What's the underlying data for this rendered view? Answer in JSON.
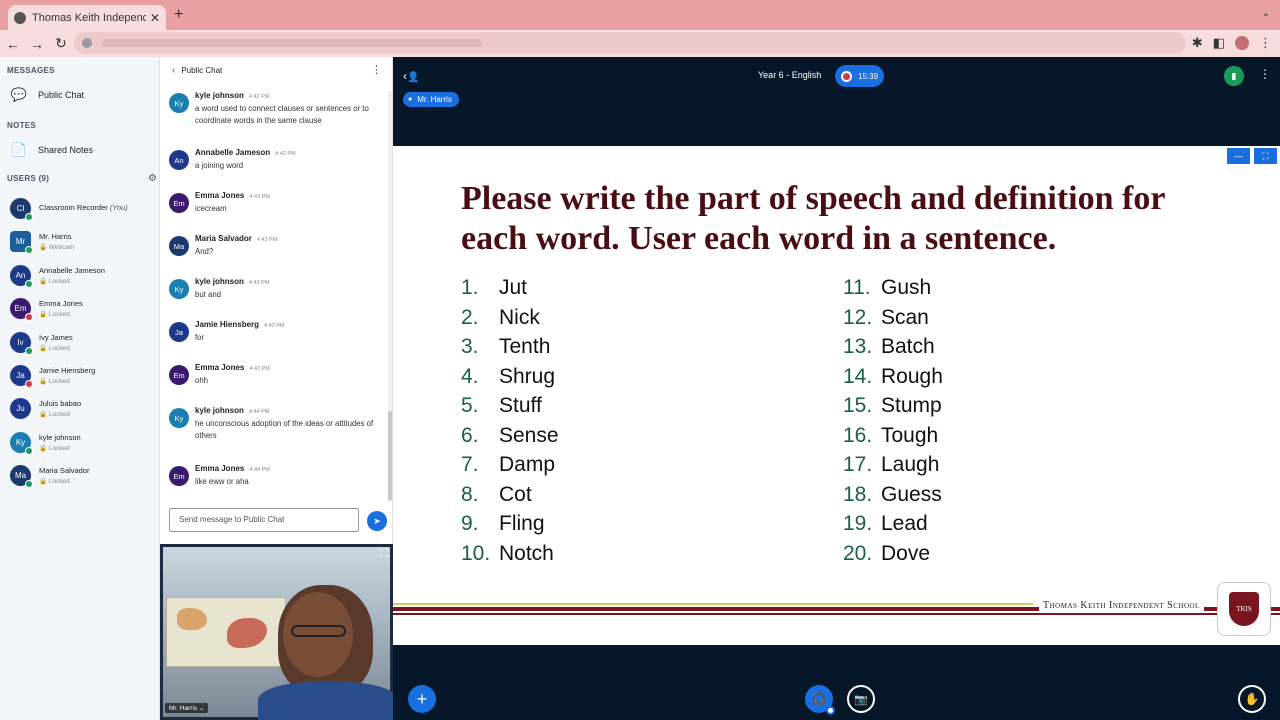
{
  "browser": {
    "tab_title": "Thomas Keith Independent Sc",
    "tab_close": "✕",
    "new_tab": "+",
    "tab_menu": "⌄"
  },
  "sidebar": {
    "messages_title": "MESSAGES",
    "public_chat": "Public Chat",
    "notes_title": "NOTES",
    "shared_notes": "Shared Notes",
    "users_title": "USERS (9)",
    "users": [
      {
        "initials": "Cl",
        "name": "Classroom Recorder",
        "suffix": "(You)",
        "sub": "",
        "color": "#1d3a6e",
        "status": "green"
      },
      {
        "initials": "Mr",
        "name": "Mr. Harris",
        "suffix": "",
        "sub": "Webcam",
        "color": "#1c5f9c",
        "status": "green"
      },
      {
        "initials": "An",
        "name": "Annabelle Jameson",
        "suffix": "",
        "sub": "Locked",
        "color": "#1d3a8a",
        "status": "green"
      },
      {
        "initials": "Em",
        "name": "Emma Jones",
        "suffix": "",
        "sub": "Locked",
        "color": "#3a1a6e",
        "status": "red"
      },
      {
        "initials": "Iv",
        "name": "Ivy James",
        "suffix": "",
        "sub": "Locked",
        "color": "#1d3a8a",
        "status": "green"
      },
      {
        "initials": "Ja",
        "name": "Jamie Hiensberg",
        "suffix": "",
        "sub": "Locked",
        "color": "#1d3a8a",
        "status": "red"
      },
      {
        "initials": "Ju",
        "name": "Juluis babao",
        "suffix": "",
        "sub": "Locked",
        "color": "#1d3a8a",
        "status": ""
      },
      {
        "initials": "Ky",
        "name": "kyle johnson",
        "suffix": "",
        "sub": "Locked",
        "color": "#1a7fb0",
        "status": "green"
      },
      {
        "initials": "Ma",
        "name": "Maria Salvador",
        "suffix": "",
        "sub": "Locked",
        "color": "#1d3a6e",
        "status": "green"
      }
    ]
  },
  "chat": {
    "title": "Public Chat",
    "input_placeholder": "Send message to Public Chat",
    "messages": [
      {
        "initials": "Ky",
        "name": "kyle johnson",
        "time": "4:42 PM",
        "text": "a word used to connect clauses or sentences or to coordinate words in the same clause",
        "color": "#1a7fb0"
      },
      {
        "initials": "An",
        "name": "Annabelle Jameson",
        "time": "4:42 PM",
        "text": "a joining word",
        "color": "#1d3a8a"
      },
      {
        "initials": "Em",
        "name": "Emma Jones",
        "time": "4:43 PM",
        "text": "icecream",
        "color": "#3a1a6e"
      },
      {
        "initials": "Ma",
        "name": "Maria Salvador",
        "time": "4:43 PM",
        "text": "And?",
        "color": "#1d3a6e"
      },
      {
        "initials": "Ky",
        "name": "kyle johnson",
        "time": "4:43 PM",
        "text": "but and",
        "color": "#1a7fb0"
      },
      {
        "initials": "Ja",
        "name": "Jamie Hiensberg",
        "time": "4:43 PM",
        "text": "for",
        "color": "#1d3a8a"
      },
      {
        "initials": "Em",
        "name": "Emma Jones",
        "time": "4:43 PM",
        "text": "ohh",
        "color": "#3a1a6e"
      },
      {
        "initials": "Ky",
        "name": "kyle johnson",
        "time": "4:44 PM",
        "text": "he unconscious adoption of the ideas or attitudes of others",
        "color": "#1a7fb0"
      },
      {
        "initials": "Em",
        "name": "Emma Jones",
        "time": "4:44 PM",
        "text": "like eww or aha",
        "color": "#3a1a6e"
      }
    ]
  },
  "webcam": {
    "name": "Mr. Harris ⌄"
  },
  "stage": {
    "meeting_title": "Year 6 - English",
    "recording_time": "15:39",
    "presenter": "Mr. Harris"
  },
  "slide": {
    "heading": "Please write the part of speech and definition for each word. User each word in a sentence.",
    "left_words": [
      {
        "num": "1.",
        "word": "Jut"
      },
      {
        "num": "2.",
        "word": "Nick"
      },
      {
        "num": "3.",
        "word": "Tenth"
      },
      {
        "num": "4.",
        "word": "Shrug"
      },
      {
        "num": "5.",
        "word": "Stuff"
      },
      {
        "num": "6.",
        "word": "Sense"
      },
      {
        "num": "7.",
        "word": "Damp"
      },
      {
        "num": "8.",
        "word": "Cot"
      },
      {
        "num": "9.",
        "word": "Fling"
      },
      {
        "num": "10.",
        "word": "Notch"
      }
    ],
    "right_words": [
      {
        "num": "11.",
        "word": "Gush"
      },
      {
        "num": "12.",
        "word": "Scan"
      },
      {
        "num": "13.",
        "word": "Batch"
      },
      {
        "num": "14.",
        "word": "Rough"
      },
      {
        "num": "15.",
        "word": "Stump"
      },
      {
        "num": "16.",
        "word": "Tough"
      },
      {
        "num": "17.",
        "word": "Laugh"
      },
      {
        "num": "18.",
        "word": "Guess"
      },
      {
        "num": "19.",
        "word": "Lead"
      },
      {
        "num": "20.",
        "word": "Dove"
      }
    ],
    "school_name": "Thomas Keith Independent School",
    "crest_text": "TKIS"
  },
  "icons": {
    "back": "←",
    "forward": "→",
    "reload": "↻",
    "extensions": "✱",
    "sidepanel": "◧",
    "menu": "⋮",
    "chat": "💬",
    "notes": "📄",
    "gear": "⚙",
    "send": "➤",
    "expand": "⛶",
    "user": "👤",
    "plus": "+",
    "headset": "🎧",
    "camera": "📷",
    "hand": "✋",
    "signal": "▮",
    "minimize": "—"
  }
}
